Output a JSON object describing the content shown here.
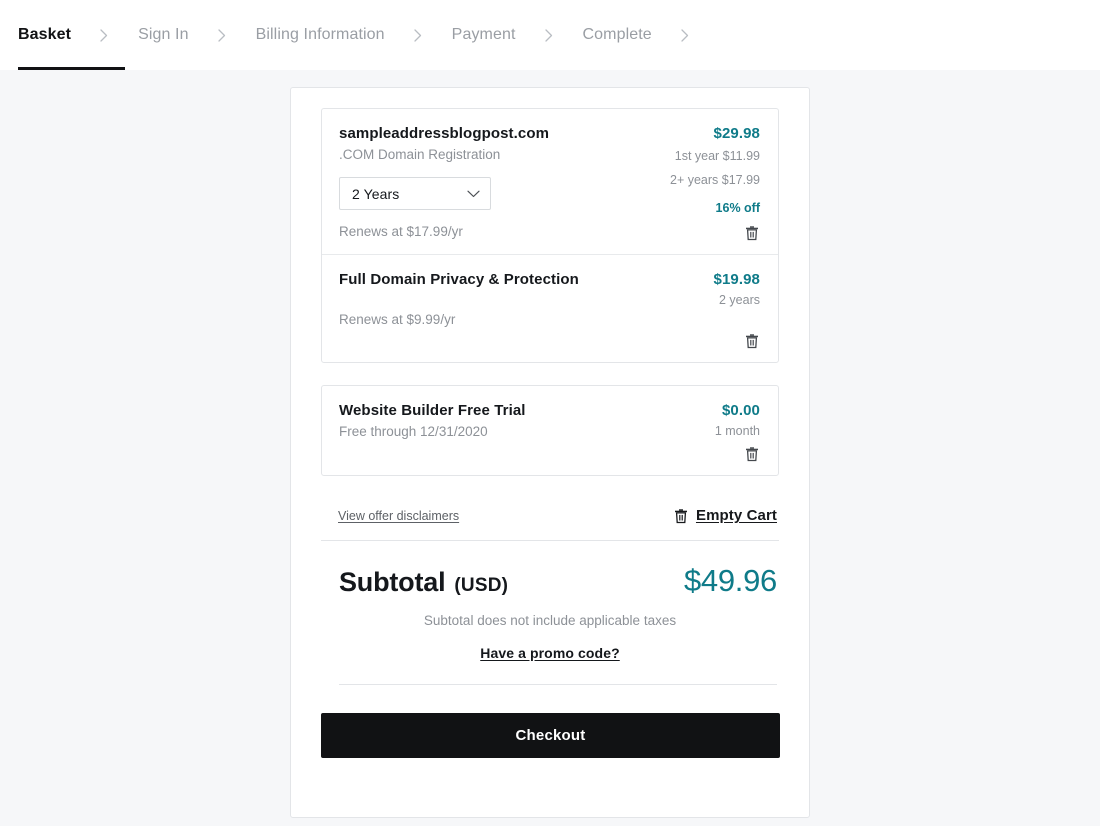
{
  "header": {
    "steps": [
      {
        "label": "Basket",
        "active": true
      },
      {
        "label": "Sign In",
        "active": false
      },
      {
        "label": "Billing Information",
        "active": false
      },
      {
        "label": "Payment",
        "active": false
      },
      {
        "label": "Complete",
        "active": false
      }
    ],
    "separator_icon": "chevron-right-icon"
  },
  "cart": {
    "groups": [
      {
        "items": [
          {
            "title": "sampleaddressblogpost.com",
            "subtitle": ".COM Domain Registration",
            "term_select": {
              "value": "2 Years",
              "icon": "chevron-down-icon"
            },
            "renews": "Renews at $17.99/yr",
            "price": "$29.98",
            "price_lines": [
              "1st year $11.99",
              "2+ years $17.99"
            ],
            "discount": "16% off",
            "remove_icon": "trash-icon"
          },
          {
            "title": "Full Domain Privacy & Protection",
            "subtitle": "",
            "renews": "Renews at $9.99/yr",
            "price": "$19.98",
            "term": "2 years",
            "remove_icon": "trash-icon"
          }
        ]
      },
      {
        "items": [
          {
            "title": "Website Builder Free Trial",
            "subtitle": "Free through 12/31/2020",
            "price": "$0.00",
            "term": "1 month",
            "remove_icon": "trash-icon"
          }
        ]
      }
    ],
    "disclaimer_link": "View offer disclaimers",
    "empty_cart": {
      "label": "Empty Cart",
      "icon": "trash-icon"
    }
  },
  "summary": {
    "subtotal_label": "Subtotal",
    "currency": "(USD)",
    "amount": "$49.96",
    "tax_note": "Subtotal does not include applicable taxes",
    "promo_link": "Have a promo code?",
    "checkout_label": "Checkout"
  },
  "colors": {
    "accent_teal": "#0f7b89",
    "text_dark": "#15181c",
    "text_muted": "#8d9197",
    "page_bg": "#f6f7f9",
    "card_border": "#e3e5e8",
    "checkout_bg": "#111214"
  }
}
